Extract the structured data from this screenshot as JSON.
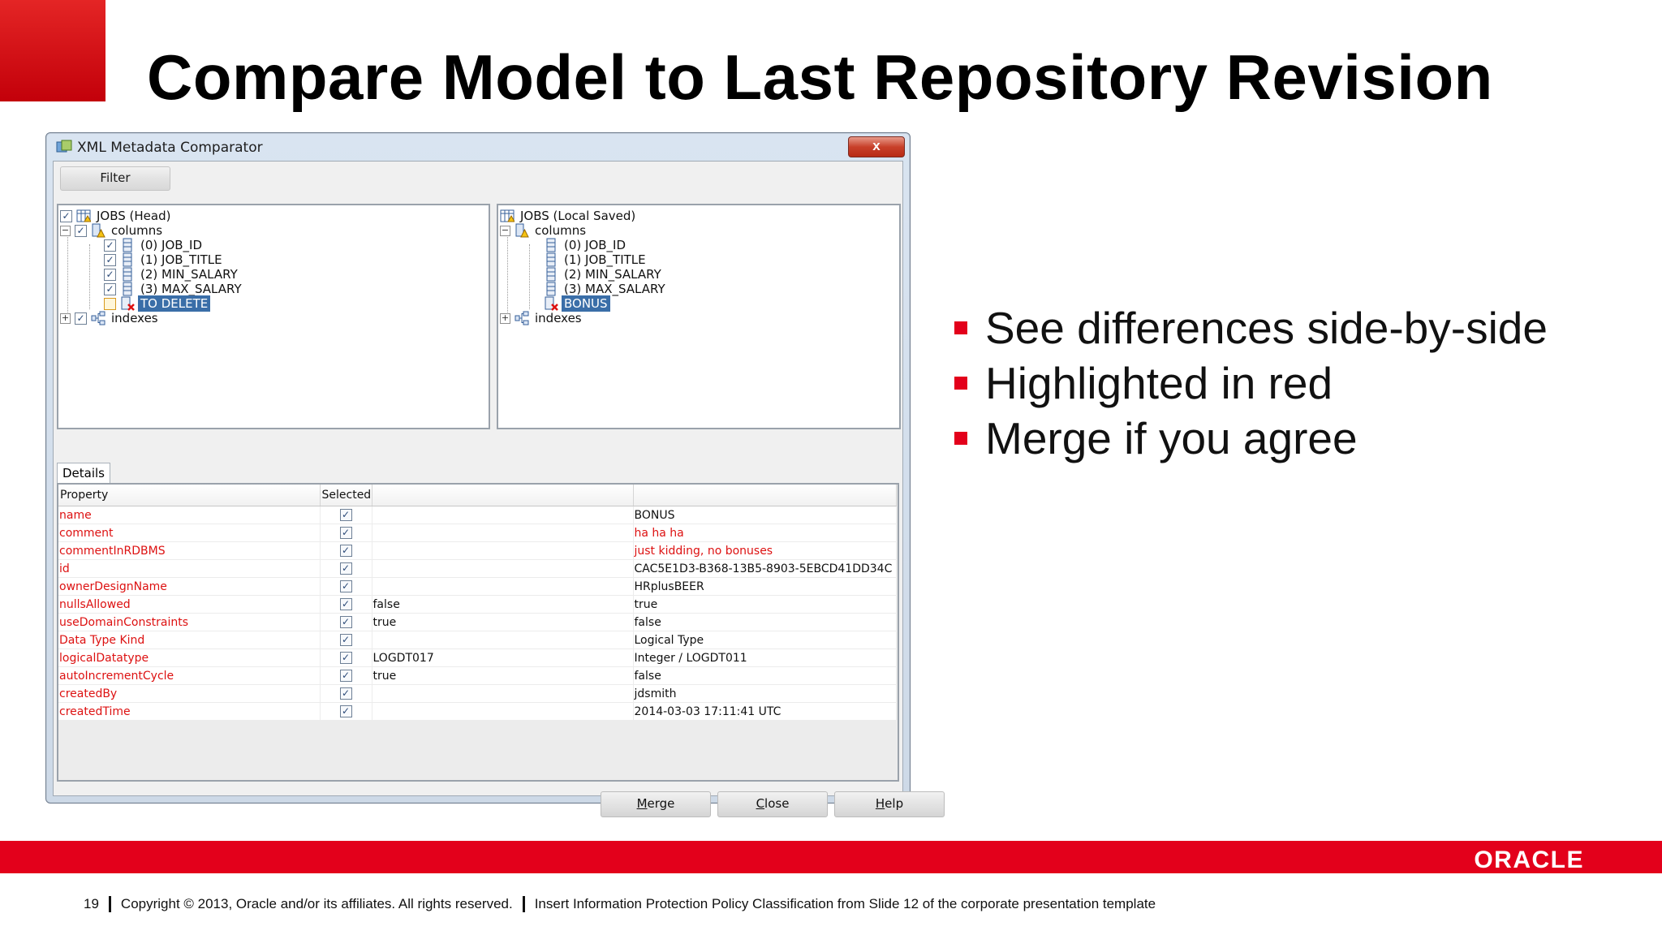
{
  "slide": {
    "title": "Compare Model to Last Repository Revision",
    "bullets": [
      "See differences side-by-side",
      "Highlighted in red",
      "Merge if you agree"
    ],
    "brand_color": "#e3001b",
    "logo_text": "ORACLE",
    "footer": {
      "page_number": "19",
      "copyright": "Copyright © 2013, Oracle and/or its affiliates. All rights reserved.",
      "classification": "Insert Information Protection Policy Classification from Slide 12 of the corporate presentation template"
    }
  },
  "window": {
    "title": "XML Metadata Comparator",
    "close_glyph": "x",
    "filter_label": "Filter",
    "details_tab": "Details",
    "buttons": {
      "merge": "Merge",
      "close": "Close",
      "help": "Help"
    }
  },
  "left_tree": {
    "root": "JOBS (Head)",
    "columns": "columns",
    "items": [
      "(0) JOB_ID",
      "(1) JOB_TITLE",
      "(2) MIN_SALARY",
      "(3) MAX_SALARY",
      "TO DELETE"
    ],
    "indexes": "indexes"
  },
  "right_tree": {
    "root": "JOBS (Local Saved)",
    "columns": "columns",
    "items": [
      "(0) JOB_ID",
      "(1) JOB_TITLE",
      "(2) MIN_SALARY",
      "(3) MAX_SALARY",
      "BONUS"
    ],
    "indexes": "indexes"
  },
  "details": {
    "headers": [
      "Property",
      "Selected",
      "",
      ""
    ],
    "rows": [
      {
        "property": "name",
        "left": "",
        "right": "BONUS",
        "right_red": false
      },
      {
        "property": "comment",
        "left": "",
        "right": "ha ha ha",
        "right_red": true
      },
      {
        "property": "commentInRDBMS",
        "left": "",
        "right": "just kidding, no bonuses",
        "right_red": true
      },
      {
        "property": "id",
        "left": "",
        "right": "CAC5E1D3-B368-13B5-8903-5EBCD41DD34C",
        "right_red": false
      },
      {
        "property": "ownerDesignName",
        "left": "",
        "right": "HRplusBEER",
        "right_red": false
      },
      {
        "property": "nullsAllowed",
        "left": "false",
        "right": "true",
        "right_red": false
      },
      {
        "property": "useDomainConstraints",
        "left": "true",
        "right": "false",
        "right_red": false
      },
      {
        "property": "Data Type Kind",
        "left": "",
        "right": "Logical Type",
        "right_red": false
      },
      {
        "property": "logicalDatatype",
        "left": "LOGDT017",
        "right": "Integer / LOGDT011",
        "right_red": false
      },
      {
        "property": "autoIncrementCycle",
        "left": "true",
        "right": "false",
        "right_red": false
      },
      {
        "property": "createdBy",
        "left": "",
        "right": "jdsmith",
        "right_red": false
      },
      {
        "property": "createdTime",
        "left": "",
        "right": "2014-03-03 17:11:41 UTC",
        "right_red": false
      }
    ]
  }
}
